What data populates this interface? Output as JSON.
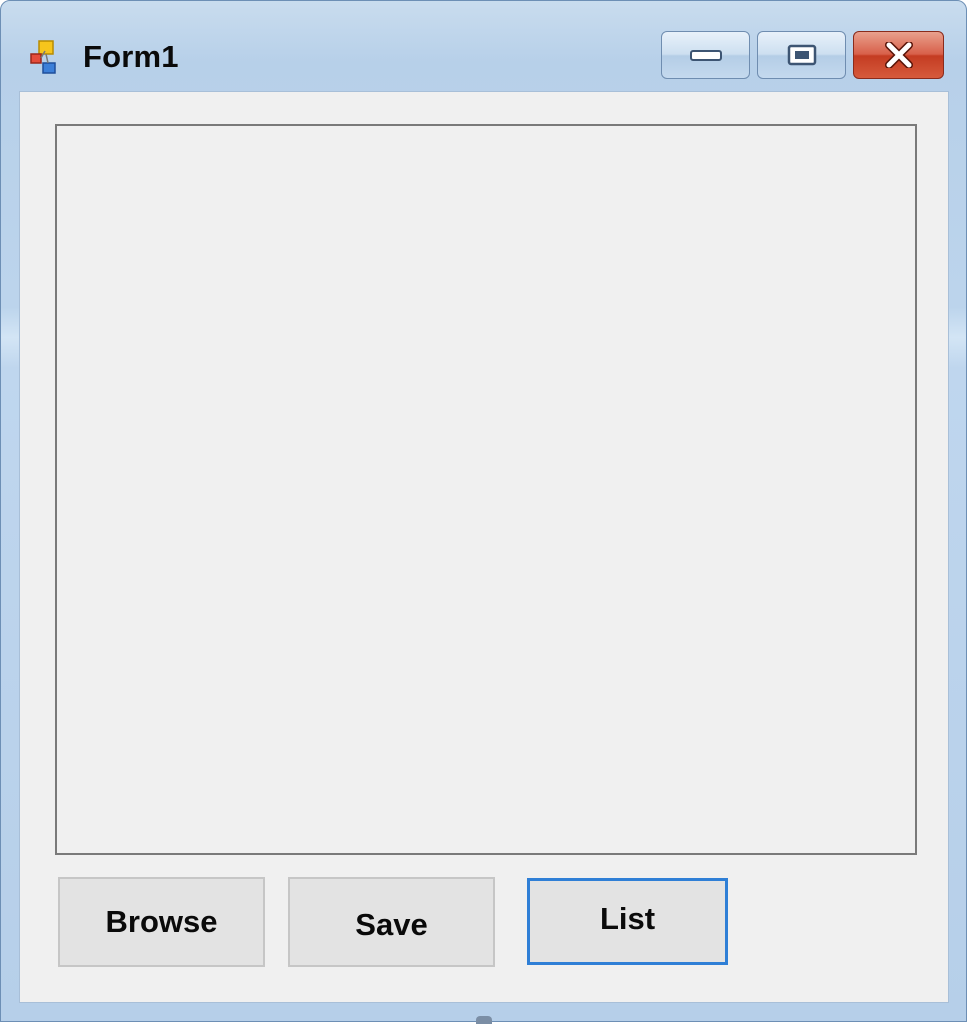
{
  "window": {
    "title": "Form1"
  },
  "buttons": {
    "browse": "Browse",
    "save": "Save",
    "list": "List"
  },
  "textarea": {
    "value": ""
  },
  "icons": {
    "app": "windows-form-icon",
    "minimize": "minimize-icon",
    "maximize": "maximize-icon",
    "close": "close-icon"
  },
  "colors": {
    "focus_border": "#2f7fd6",
    "close_button": "#c9452b",
    "client_background": "#f0f0f0"
  }
}
